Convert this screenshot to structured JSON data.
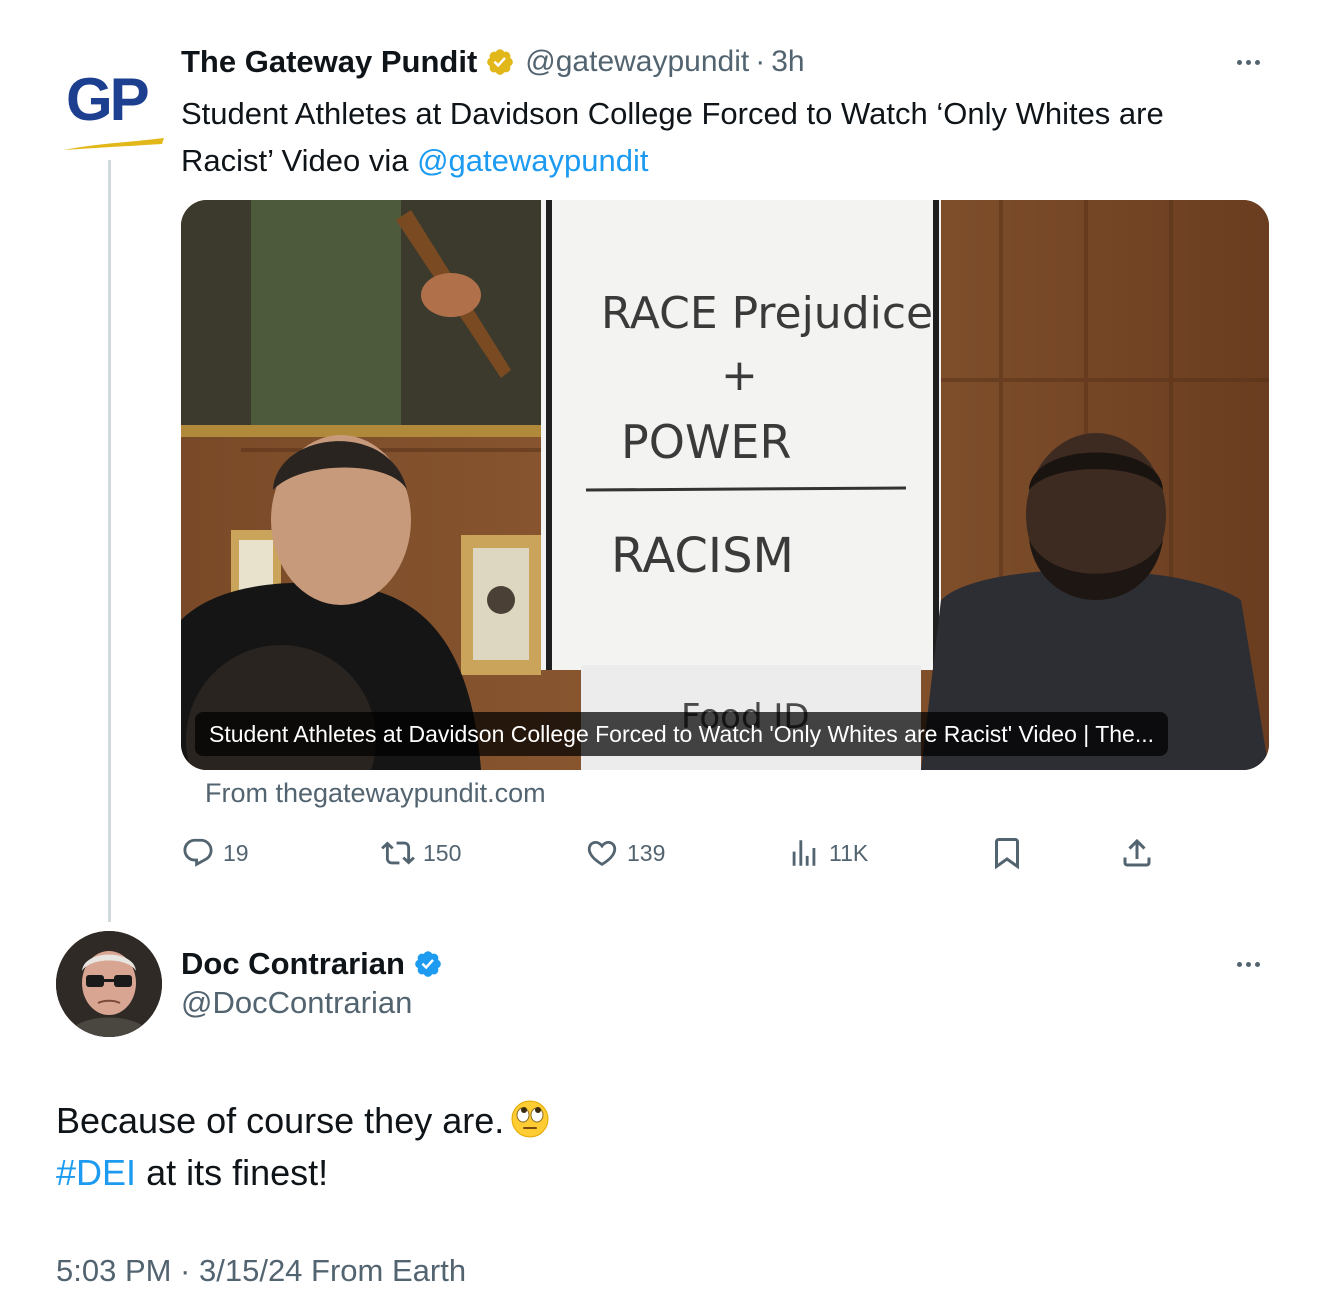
{
  "parent_tweet": {
    "logo_text": "GP",
    "author_name": "The Gateway Pundit",
    "handle": "@gatewaypundit",
    "separator": "·",
    "time": "3h",
    "text_line1": "Student Athletes at Davidson College Forced to Watch ‘Only Whites are",
    "text_line2": "Racist’ Video via",
    "mention": "@gatewaypundit",
    "verified_badge": "gold-verified-badge",
    "card": {
      "caption": "Student Athletes at Davidson College Forced to Watch 'Only Whites are Racist' Video | The...",
      "whiteboard_line1": "RACE Prejudice",
      "whiteboard_plus": "+",
      "whiteboard_line2": "POWER",
      "whiteboard_line3": "RACISM",
      "lower_sign": "Food ID"
    },
    "source": "From thegatewaypundit.com",
    "actions": {
      "replies": "19",
      "reposts": "150",
      "likes": "139",
      "views": "11K"
    }
  },
  "main_tweet": {
    "author_name": "Doc Contrarian",
    "handle": "@DocContrarian",
    "verified_badge": "blue-verified-badge",
    "text_line1": "Because of course they are.",
    "emoji": "face-with-rolling-eyes",
    "hashtag": "#DEI",
    "text_line2_rest": "at its finest!",
    "timestamp": "5:03 PM · 3/15/24 From Earth"
  },
  "colors": {
    "link": "#1d9bf0",
    "secondary_text": "#536471",
    "thread_line": "#cfd9de",
    "gold_badge": "#e2b719",
    "blue_badge": "#1d9bf0",
    "gp_blue": "#1c3f8f"
  }
}
